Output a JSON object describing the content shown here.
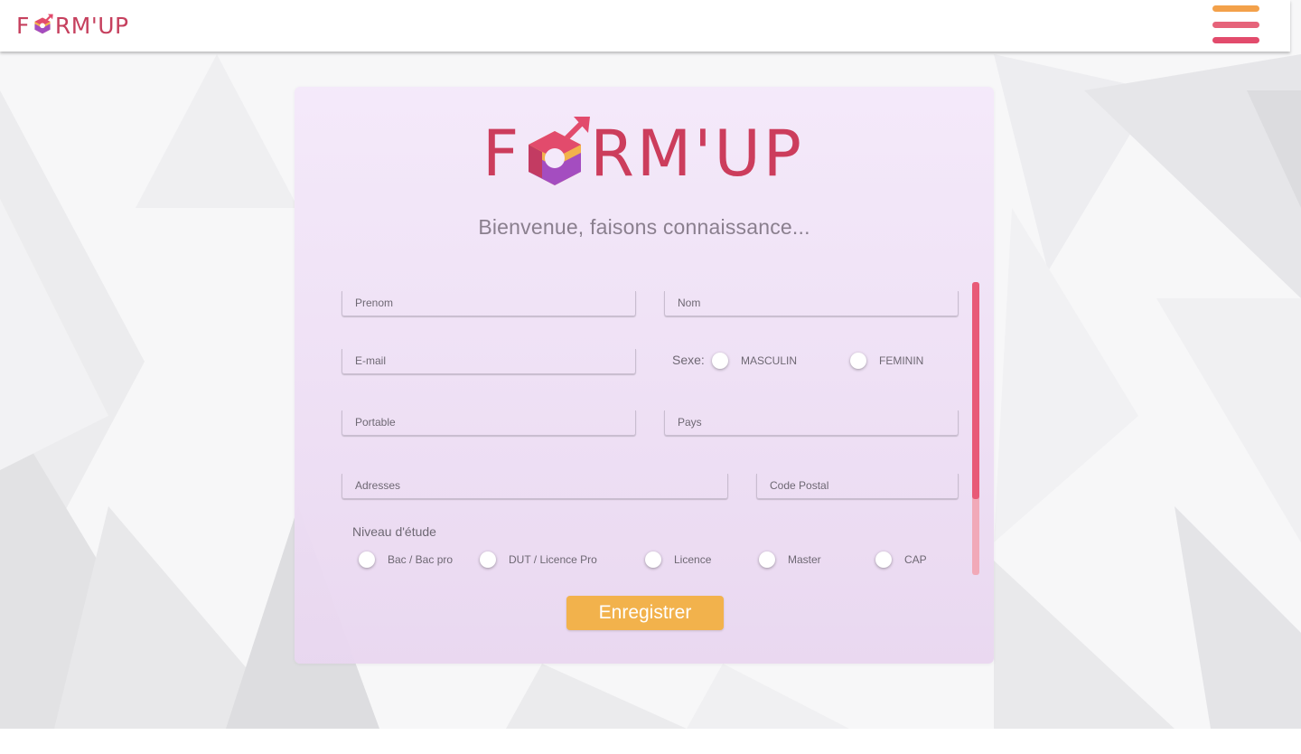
{
  "header": {
    "brand_prefix": "F",
    "brand_suffix": "RM'UP",
    "menu_icon": "hamburger-menu-icon",
    "menu_colors": [
      "#f3a14a",
      "#e6637a",
      "#e24b6c"
    ]
  },
  "card": {
    "brand_prefix": "F",
    "brand_suffix": "RM'UP",
    "welcome": "Bienvenue, faisons connaissance..."
  },
  "form": {
    "prenom": {
      "placeholder": "Prenom"
    },
    "nom": {
      "placeholder": "Nom"
    },
    "email": {
      "placeholder": "E-mail"
    },
    "sexe": {
      "label": "Sexe:",
      "options": [
        "MASCULIN",
        "FEMININ"
      ]
    },
    "portable": {
      "placeholder": "Portable"
    },
    "pays": {
      "placeholder": "Pays"
    },
    "adresses": {
      "placeholder": "Adresses"
    },
    "code_postal": {
      "placeholder": "Code Postal"
    },
    "niveau": {
      "label": "Niveau d'étude",
      "options": [
        "Bac / Bac pro",
        "DUT / Licence Pro",
        "Licence",
        "Master",
        "CAP"
      ]
    },
    "save_label": "Enregistrer"
  },
  "colors": {
    "brand": "#cc3d5c",
    "accent_button": "#f2b24c",
    "scrollbar": "#e85a77",
    "card_bg": "#f1e4f6"
  }
}
